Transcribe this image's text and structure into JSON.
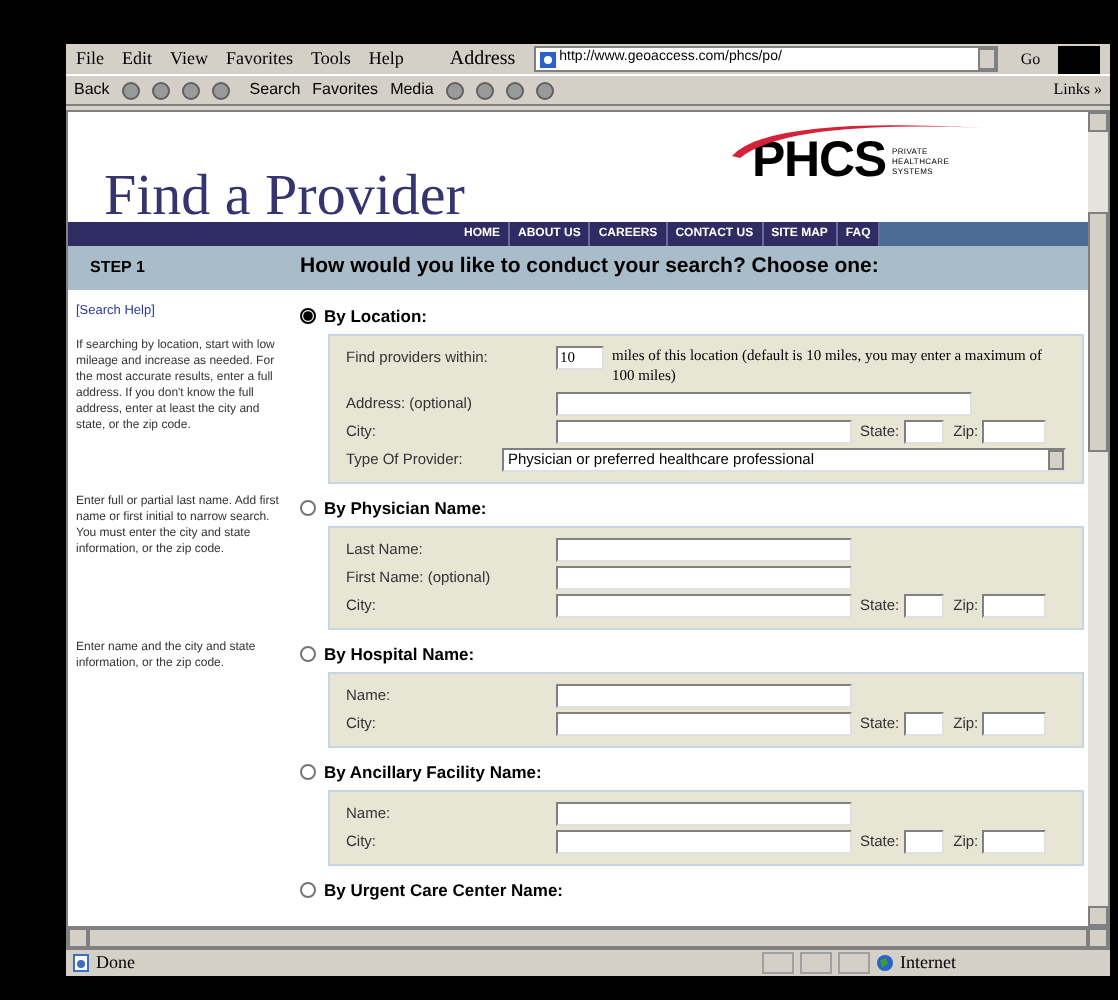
{
  "menu_bar": {
    "items": [
      "File",
      "Edit",
      "View",
      "Favorites",
      "Tools",
      "Help"
    ],
    "address_label": "Address",
    "address": "http://www.geoaccess.com/phcs/po/",
    "go": "Go"
  },
  "toolbar": {
    "back": "Back",
    "search": "Search",
    "favorites": "Favorites",
    "media": "Media",
    "links": "Links »"
  },
  "header": {
    "title": "Find a Provider",
    "logo": "PHCS",
    "tagline": [
      "PRIVATE",
      "HEALTHCARE",
      "SYSTEMS"
    ]
  },
  "nav": [
    "HOME",
    "ABOUT US",
    "CAREERS",
    "CONTACT US",
    "SITE MAP",
    "FAQ"
  ],
  "step": {
    "label": "STEP 1",
    "question": "How would you like to conduct your search? Choose one:"
  },
  "sidebar": {
    "help_link": "[Search Help]"
  },
  "options": [
    {
      "label": "By Location:",
      "selected": true,
      "help": "If searching by location, start with low mileage and increase as needed. For the most accurate results, enter a full address. If you don't know the full address, enter at least the city and state, or the zip code.",
      "fields": [
        {
          "kind": "radius",
          "label": "Find providers within:",
          "value": "10",
          "note": "miles of this location (default is 10 miles, you may enter a maximum of 100 miles)"
        },
        {
          "kind": "text",
          "label": "Address: (optional)"
        },
        {
          "kind": "city",
          "label": "City:",
          "state_label": "State:",
          "zip_label": "Zip:"
        },
        {
          "kind": "select",
          "label": "Type Of Provider:",
          "value": "Physician or preferred healthcare professional"
        }
      ]
    },
    {
      "label": "By Physician Name:",
      "selected": false,
      "help": "Enter full or partial last name. Add first name or first initial to narrow search. You must enter the city and state information, or the zip code.",
      "fields": [
        {
          "kind": "name",
          "label": "Last Name:"
        },
        {
          "kind": "name",
          "label": "First Name: (optional)"
        },
        {
          "kind": "city",
          "label": "City:",
          "state_label": "State:",
          "zip_label": "Zip:"
        }
      ]
    },
    {
      "label": "By Hospital Name:",
      "selected": false,
      "help": "Enter name and the city and state information, or the zip code.",
      "fields": [
        {
          "kind": "name",
          "label": "Name:"
        },
        {
          "kind": "city",
          "label": "City:",
          "state_label": "State:",
          "zip_label": "Zip:"
        }
      ]
    },
    {
      "label": "By Ancillary Facility Name:",
      "selected": false,
      "fields": [
        {
          "kind": "name",
          "label": "Name:"
        },
        {
          "kind": "city",
          "label": "City:",
          "state_label": "State:",
          "zip_label": "Zip:"
        }
      ]
    },
    {
      "label": "By Urgent Care Center Name:",
      "selected": false
    }
  ],
  "status_bar": {
    "text": "Done",
    "zone": "Internet"
  }
}
